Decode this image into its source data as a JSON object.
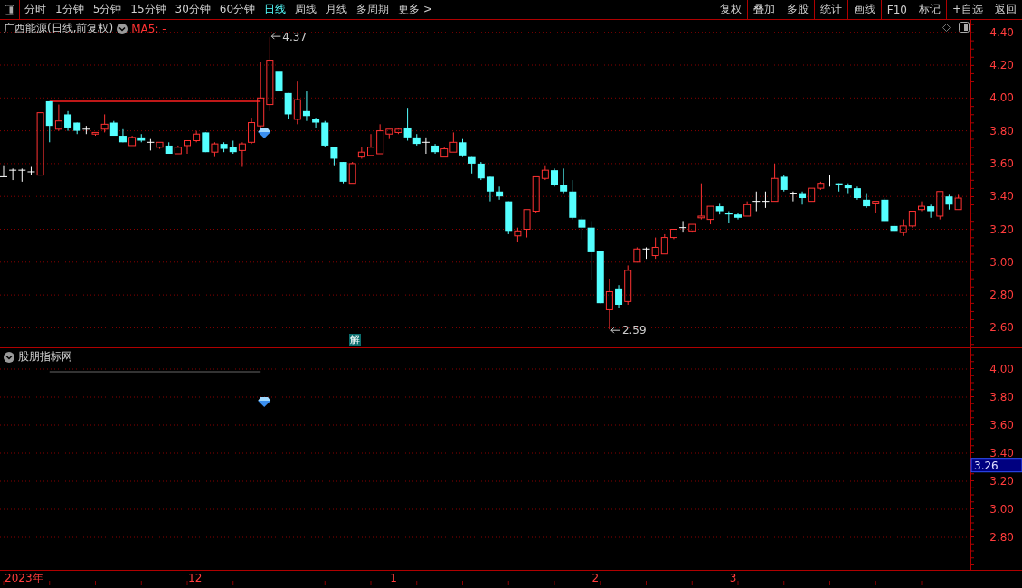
{
  "toolbar": {
    "periods": [
      {
        "label": "分时",
        "selected": false
      },
      {
        "label": "1分钟",
        "selected": false
      },
      {
        "label": "5分钟",
        "selected": false
      },
      {
        "label": "15分钟",
        "selected": false
      },
      {
        "label": "30分钟",
        "selected": false
      },
      {
        "label": "60分钟",
        "selected": false
      },
      {
        "label": "日线",
        "selected": true
      },
      {
        "label": "周线",
        "selected": false
      },
      {
        "label": "月线",
        "selected": false
      },
      {
        "label": "多周期",
        "selected": false
      },
      {
        "label": "更多 >",
        "selected": false
      }
    ],
    "buttons": [
      "复权",
      "叠加",
      "多股",
      "统计",
      "画线",
      "F10",
      "标记",
      "+自选",
      "返回"
    ]
  },
  "price_chart": {
    "title": "广西能源(日线,前复权)",
    "ma_label": "MA5: -",
    "high_label": "4.37",
    "low_label": "2.59",
    "badge": "解",
    "yticks": [
      "4.40",
      "4.20",
      "4.00",
      "3.80",
      "3.60",
      "3.40",
      "3.20",
      "3.00",
      "2.80",
      "2.60"
    ]
  },
  "indicator": {
    "title": "股朋指标网",
    "yticks": [
      "4.00",
      "3.80",
      "3.60",
      "3.40",
      "3.20",
      "3.00",
      "2.80"
    ],
    "last_value": "3.26"
  },
  "time_axis": [
    "2023年",
    "12",
    "1",
    "2",
    "3"
  ]
}
